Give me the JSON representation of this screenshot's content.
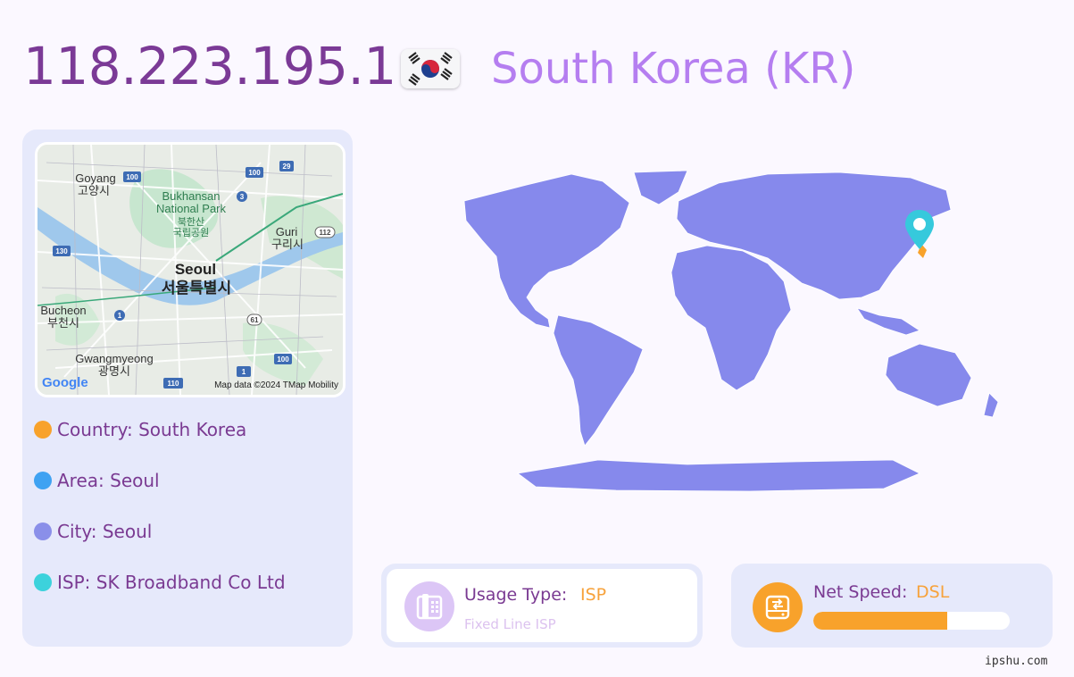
{
  "header": {
    "ip": "118.223.195.1",
    "country_title": "South Korea (KR)"
  },
  "map_labels": {
    "goyang": "Goyang",
    "goyang_ko": "고양시",
    "park1": "Bukhansan",
    "park2": "National Park",
    "park_ko1": "북한산",
    "park_ko2": "국립공원",
    "guri": "Guri",
    "guri_ko": "구리시",
    "seoul": "Seoul",
    "seoul_ko": "서울특별시",
    "bucheon": "Bucheon",
    "bucheon_ko": "부천시",
    "gwangmyeong": "Gwangmyeong",
    "gwangmyeong_ko": "광명시",
    "attribution": "Map data ©2024 TMap Mobility",
    "google": "Google",
    "route_100": "100",
    "route_29": "29",
    "route_3": "3",
    "route_130": "130",
    "route_112": "112",
    "route_1": "1",
    "route_61": "61",
    "route_110": "110"
  },
  "info": {
    "country": "Country: South Korea",
    "area": "Area: Seoul",
    "city": "City: Seoul",
    "isp": "ISP: SK Broadband Co Ltd"
  },
  "usage": {
    "label": "Usage Type:",
    "value": "ISP",
    "sub": "Fixed Line ISP"
  },
  "speed": {
    "label": "Net Speed:",
    "value": "DSL",
    "level": 0.68
  },
  "watermark": "ipshu.com",
  "colors": {
    "ip_text": "#7b3a96",
    "country_text": "#b57ef0",
    "card_bg": "#e6e9fb",
    "world_fill": "#8689ec",
    "dot_country": "#f8a22b",
    "dot_area": "#3fa2f2",
    "dot_city": "#8a8fe9",
    "dot_isp": "#3cd2dc",
    "pin": "#36c9dc",
    "usage_icon_bg": "#dcc6f6",
    "speed_icon_bg": "#f8a22b",
    "speed_bar": "#f8a22b"
  },
  "icons": {
    "flag": "south-korea-flag-icon",
    "usage": "telephone-icon",
    "speed": "router-icon",
    "pin": "map-pin-icon"
  }
}
